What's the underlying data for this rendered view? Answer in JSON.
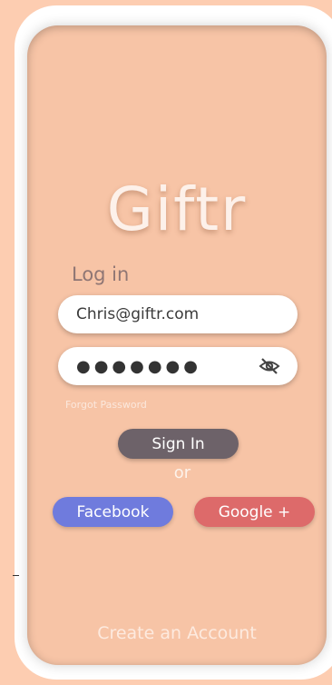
{
  "app": {
    "logo_text": "Giftr"
  },
  "login": {
    "heading": "Log in",
    "email_value": "Chris@giftr.com",
    "password_masked": "●●●●●●●",
    "forgot_password": "Forgot Password",
    "sign_in_label": "Sign In",
    "or_label": "or"
  },
  "social": {
    "facebook_label": "Facebook",
    "google_label": "Google +"
  },
  "footer": {
    "create_account": "Create an Account"
  },
  "icons": {
    "password_toggle": "eye-off-icon"
  },
  "colors": {
    "background": "#fdcdb1",
    "screen": "#f7c4a6",
    "sign_in": "#6d6269",
    "facebook": "#6f7bdd",
    "google": "#dd6a6a"
  }
}
